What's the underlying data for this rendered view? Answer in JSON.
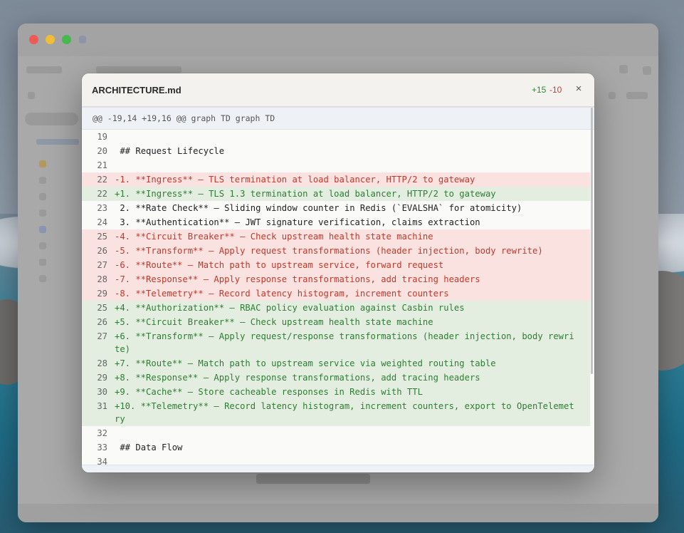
{
  "modal": {
    "filename": "ARCHITECTURE.md",
    "additions": "+15",
    "deletions": "-10",
    "close_glyph": "×",
    "hunk_header": "@@ -19,14 +19,16 @@ graph TD graph TD",
    "lines": [
      {
        "type": "ctx",
        "num": "19",
        "text": ""
      },
      {
        "type": "ctx",
        "num": "20",
        "text": " ## Request Lifecycle"
      },
      {
        "type": "ctx",
        "num": "21",
        "text": ""
      },
      {
        "type": "del",
        "num": "22",
        "text": "-1. **Ingress** — TLS termination at load balancer, HTTP/2 to gateway"
      },
      {
        "type": "add",
        "num": "22",
        "text": "+1. **Ingress** — TLS 1.3 termination at load balancer, HTTP/2 to gateway"
      },
      {
        "type": "ctx",
        "num": "23",
        "text": " 2. **Rate Check** — Sliding window counter in Redis (`EVALSHA` for atomicity)"
      },
      {
        "type": "ctx",
        "num": "24",
        "text": " 3. **Authentication** — JWT signature verification, claims extraction"
      },
      {
        "type": "del",
        "num": "25",
        "text": "-4. **Circuit Breaker** — Check upstream health state machine"
      },
      {
        "type": "del",
        "num": "26",
        "text": "-5. **Transform** — Apply request transformations (header injection, body rewrite)"
      },
      {
        "type": "del",
        "num": "27",
        "text": "-6. **Route** — Match path to upstream service, forward request"
      },
      {
        "type": "del",
        "num": "28",
        "text": "-7. **Response** — Apply response transformations, add tracing headers"
      },
      {
        "type": "del",
        "num": "29",
        "text": "-8. **Telemetry** — Record latency histogram, increment counters"
      },
      {
        "type": "add",
        "num": "25",
        "text": "+4. **Authorization** — RBAC policy evaluation against Casbin rules"
      },
      {
        "type": "add",
        "num": "26",
        "text": "+5. **Circuit Breaker** — Check upstream health state machine"
      },
      {
        "type": "add",
        "num": "27",
        "text": "+6. **Transform** — Apply request/response transformations (header injection, body rewrite)"
      },
      {
        "type": "add",
        "num": "28",
        "text": "+7. **Route** — Match path to upstream service via weighted routing table"
      },
      {
        "type": "add",
        "num": "29",
        "text": "+8. **Response** — Apply response transformations, add tracing headers"
      },
      {
        "type": "add",
        "num": "30",
        "text": "+9. **Cache** — Store cacheable responses in Redis with TTL"
      },
      {
        "type": "add",
        "num": "31",
        "text": "+10. **Telemetry** — Record latency histogram, increment counters, export to OpenTelemetry"
      },
      {
        "type": "ctx",
        "num": "32",
        "text": ""
      },
      {
        "type": "ctx",
        "num": "33",
        "text": " ## Data Flow"
      },
      {
        "type": "ctx",
        "num": "34",
        "text": ""
      }
    ]
  },
  "colors": {
    "addition": "#2e7d32",
    "deletion": "#c0392b",
    "add_bg": "#e3eee0",
    "del_bg": "#f9e2e0"
  }
}
